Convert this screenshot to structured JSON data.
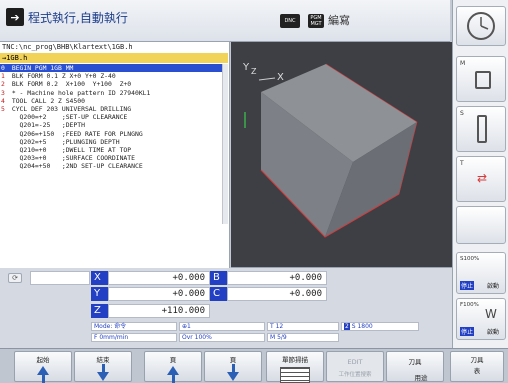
{
  "header": {
    "mode_main": "程式執行,自動執行",
    "chip_dnc": "DNC",
    "chip_pgm": "PGM MGT",
    "mode_second": "編寫"
  },
  "program": {
    "path": "TNC:\\nc_prog\\BHB\\Klartext\\1GB.h",
    "file": "→1GB.h",
    "lines": [
      {
        "n": "0",
        "text": " BEGIN PGM 1GB MM",
        "selected": true
      },
      {
        "n": "1",
        "text": " BLK FORM 0.1 Z X+0 Y+0 Z-40"
      },
      {
        "n": "2",
        "text": " BLK FORM 0.2  X+100  Y+100  Z+0"
      },
      {
        "n": "3",
        "text": " * - Machine hole pattern ID 27940KL1"
      },
      {
        "n": "4",
        "text": " TOOL CALL 2 Z S4500"
      },
      {
        "n": "5",
        "text": " CYCL DEF 203 UNIVERSAL DRILLING"
      },
      {
        "n": "",
        "text": "   Q200=+2    ;SET-UP CLEARANCE"
      },
      {
        "n": "",
        "text": "   Q201=-25   ;DEPTH"
      },
      {
        "n": "",
        "text": "   Q206=+150  ;FEED RATE FOR PLNGNG"
      },
      {
        "n": "",
        "text": "   Q202=+5    ;PLUNGING DEPTH"
      },
      {
        "n": "",
        "text": "   Q210=+0    ;DWELL TIME AT TOP"
      },
      {
        "n": "",
        "text": "   Q203=+0    ;SURFACE COORDINATE"
      },
      {
        "n": "",
        "text": "   Q204=+50   ;2ND SET-UP CLEARANCE"
      }
    ],
    "s_ovr": "100% S-OVR",
    "f_ovr": "100% F-OVR",
    "limit": "LIMIT 1"
  },
  "view": {
    "axis_y": "Y",
    "axis_z": "Z",
    "axis_x": "X"
  },
  "positions": {
    "X": "+0.000",
    "B": "+0.000",
    "Y": "+0.000",
    "C": "+0.000",
    "Z": "+110.000"
  },
  "status": {
    "mode": "Mode: 命令",
    "icon_val": "1",
    "tool": "T 12",
    "spindle": "S 1800",
    "feed": "F 0mm/min",
    "ovr": "Ovr 100%",
    "m": "M 5/9"
  },
  "right": {
    "m": "M",
    "s": "S",
    "t": "T",
    "s100": "S100%",
    "stop": "停止",
    "start": "啟動",
    "f100": "F100%",
    "stop2": "停止",
    "start2": "啟動"
  },
  "softkeys": {
    "begin": "起始",
    "end": "結束",
    "page1": "頁",
    "page2": "頁",
    "block_scan": "單節掃描",
    "edit": "EDIT",
    "edit_sub": "工作位置搜索",
    "tool": "刀具",
    "tool_use": "用途",
    "tool_table": "刀具",
    "tool_table2": "表"
  }
}
